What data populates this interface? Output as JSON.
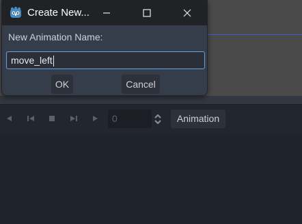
{
  "dialog": {
    "title": "Create New...",
    "field_label": "New Animation Name:",
    "name_value": "move_left",
    "ok_label": "OK",
    "cancel_label": "Cancel"
  },
  "toolbar": {
    "frame_value": "0",
    "animation_button_label": "Animation"
  },
  "colors": {
    "accent": "#6ba0e0",
    "dialog_bg": "#363d4a",
    "titlebar_bg": "#202226",
    "panel_bg": "#1f232b",
    "viewport_bg": "#4a4a4a"
  },
  "icons": [
    "godot-logo-icon",
    "minimize-icon",
    "maximize-icon",
    "close-icon",
    "play-backward-icon",
    "step-backward-icon",
    "stop-icon",
    "step-forward-icon",
    "play-forward-icon",
    "spin-arrows-icon"
  ]
}
